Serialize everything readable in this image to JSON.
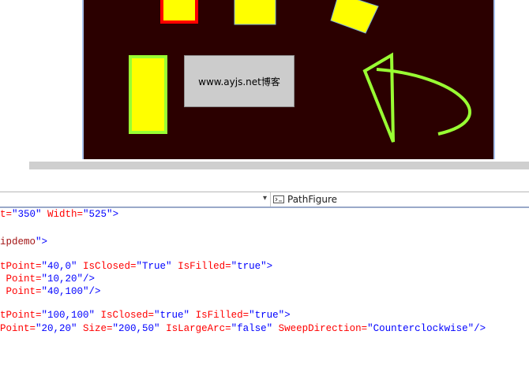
{
  "canvas": {
    "button_label": "www.ayjs.net博客"
  },
  "nav": {
    "left_dropdown_value": "",
    "right_dropdown_label": "PathFigure"
  },
  "code_lines": [
    [
      {
        "t": "t=",
        "c": "attr"
      },
      {
        "t": "\"350\"",
        "c": "val"
      },
      {
        "t": " Width=",
        "c": "attr"
      },
      {
        "t": "\"525\"",
        "c": "val"
      },
      {
        "t": ">",
        "c": "ptext"
      }
    ],
    [],
    [
      {
        "t": "ipdemo",
        "c": "tag"
      },
      {
        "t": "\">",
        "c": "ptext"
      }
    ],
    [],
    [
      {
        "t": "tPoint=",
        "c": "attr"
      },
      {
        "t": "\"40,0\"",
        "c": "val"
      },
      {
        "t": " IsClosed=",
        "c": "attr"
      },
      {
        "t": "\"True\"",
        "c": "val"
      },
      {
        "t": " IsFilled=",
        "c": "attr"
      },
      {
        "t": "\"true\"",
        "c": "val"
      },
      {
        "t": ">",
        "c": "ptext"
      }
    ],
    [
      {
        "t": " Point=",
        "c": "attr"
      },
      {
        "t": "\"10,20\"",
        "c": "val"
      },
      {
        "t": "/>",
        "c": "ptext"
      }
    ],
    [
      {
        "t": " Point=",
        "c": "attr"
      },
      {
        "t": "\"40,100\"",
        "c": "val"
      },
      {
        "t": "/>",
        "c": "ptext"
      }
    ],
    [],
    [
      {
        "t": "tPoint=",
        "c": "attr"
      },
      {
        "t": "\"100,100\"",
        "c": "val"
      },
      {
        "t": " IsClosed=",
        "c": "attr"
      },
      {
        "t": "\"true\"",
        "c": "val"
      },
      {
        "t": " IsFilled=",
        "c": "attr"
      },
      {
        "t": "\"true\"",
        "c": "val"
      },
      {
        "t": ">",
        "c": "ptext"
      }
    ],
    [
      {
        "t": "Point=",
        "c": "attr"
      },
      {
        "t": "\"20,20\"",
        "c": "val"
      },
      {
        "t": " Size=",
        "c": "attr"
      },
      {
        "t": "\"200,50\"",
        "c": "val"
      },
      {
        "t": " IsLargeArc=",
        "c": "attr"
      },
      {
        "t": "\"false\"",
        "c": "val"
      },
      {
        "t": " SweepDirection=",
        "c": "attr"
      },
      {
        "t": "\"Counterclockwise\"",
        "c": "val"
      },
      {
        "t": "/>",
        "c": "ptext"
      }
    ]
  ],
  "icons": {
    "dropdown_arrow": "chevron-down-icon",
    "pathfigure": "xaml-element-icon"
  },
  "colors": {
    "canvas_bg": "#2b0000",
    "shape_fill": "#ffff00",
    "shape_stroke_green": "#99ff33",
    "shape_stroke_red": "#ff0000"
  }
}
